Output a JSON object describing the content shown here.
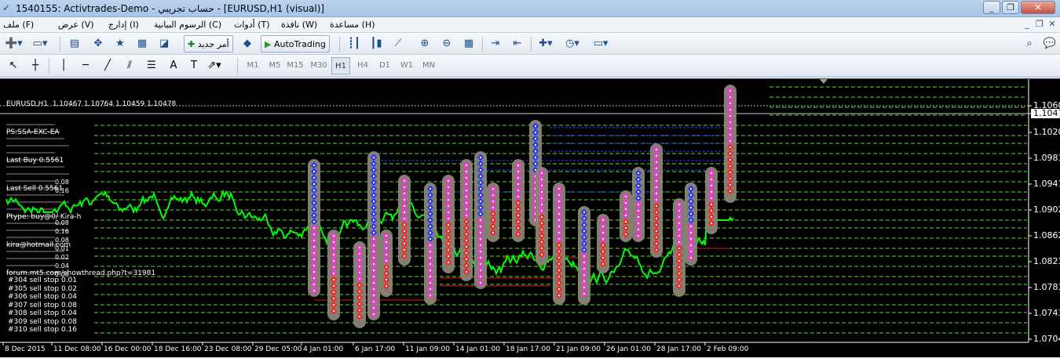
{
  "window": {
    "title": "1540155: Activtrades-Demo - حساب تجريبي - [EURUSD,H1 (visual)]",
    "app_icon": "metatrader-icon",
    "controls": [
      "_",
      "❐",
      "✕"
    ]
  },
  "menu": {
    "items": [
      "ملف (F)",
      "عرض (V)",
      "إدارج (I)",
      "الرسوم البيانية (C)",
      "أدوات (T)",
      "نافذة (W)",
      "مساعدة (H)"
    ],
    "mdi_controls": [
      "_",
      "❐",
      "✕"
    ]
  },
  "toolbar": {
    "new_order_label": "أمر جديد",
    "autotrading_label": "AutoTrading"
  },
  "timeframes": [
    "M1",
    "M5",
    "M15",
    "M30",
    "H1",
    "H4",
    "D1",
    "W1",
    "MN"
  ],
  "selected_timeframe": "H1",
  "chart": {
    "header": "EURUSD,H1  1.10467 1.10764 1.10459 1.10478",
    "info_lines": [
      "PS:SSA-EXC-EA",
      "Last Buy 0.5561",
      "Last Sell 0.5561",
      "Ptype: buy@0/ Kira-h",
      "kira@hotmail.com",
      "forum.mt5.com/showthread.php?t=31981"
    ],
    "legend_values": [
      "0.08",
      "0.16",
      "0.08",
      "0.16",
      "0.08",
      "0.01",
      "0.02",
      "0.04",
      "0.08"
    ],
    "orders": [
      "#304 sell stop 0.01",
      "#305 sell stop 0.02",
      "#306 sell stop 0.04",
      "#307 sell stop 0.08",
      "#308 sell stop 0.04",
      "#309 sell stop 0.08",
      "#310 sell stop 0.16"
    ],
    "current_price": "1.10475",
    "price_scale": [
      "1.10600",
      "1.10475",
      "1.10200",
      "1.09810",
      "1.09410",
      "1.09020",
      "1.08620",
      "1.08230",
      "1.07830",
      "1.07430",
      "1.07040"
    ],
    "time_axis": [
      "8 Dec 2015",
      "11 Dec 08:00",
      "16 Dec 00:00",
      "18 Dec 16:00",
      "23 Dec 08:00",
      "29 Dec 05:00",
      "4 Jan 01:00",
      "6 Jan 17:00",
      "11 Jan 09:00",
      "14 Jan 01:00",
      "18 Jan 17:00",
      "21 Jan 09:00",
      "26 Jan 01:00",
      "28 Jan 17:00",
      "2 Feb 09:00"
    ],
    "colors": {
      "background": "#000000",
      "price_line": "#00ff00",
      "grid_dash": "#7cff3c",
      "blue_marker": "#2a35ff",
      "pink_marker": "#ff33dd",
      "red_marker": "#ff2222",
      "highlight": "#8a8576",
      "buy_line": "#3344ff",
      "sell_line": "#cc2222"
    }
  }
}
